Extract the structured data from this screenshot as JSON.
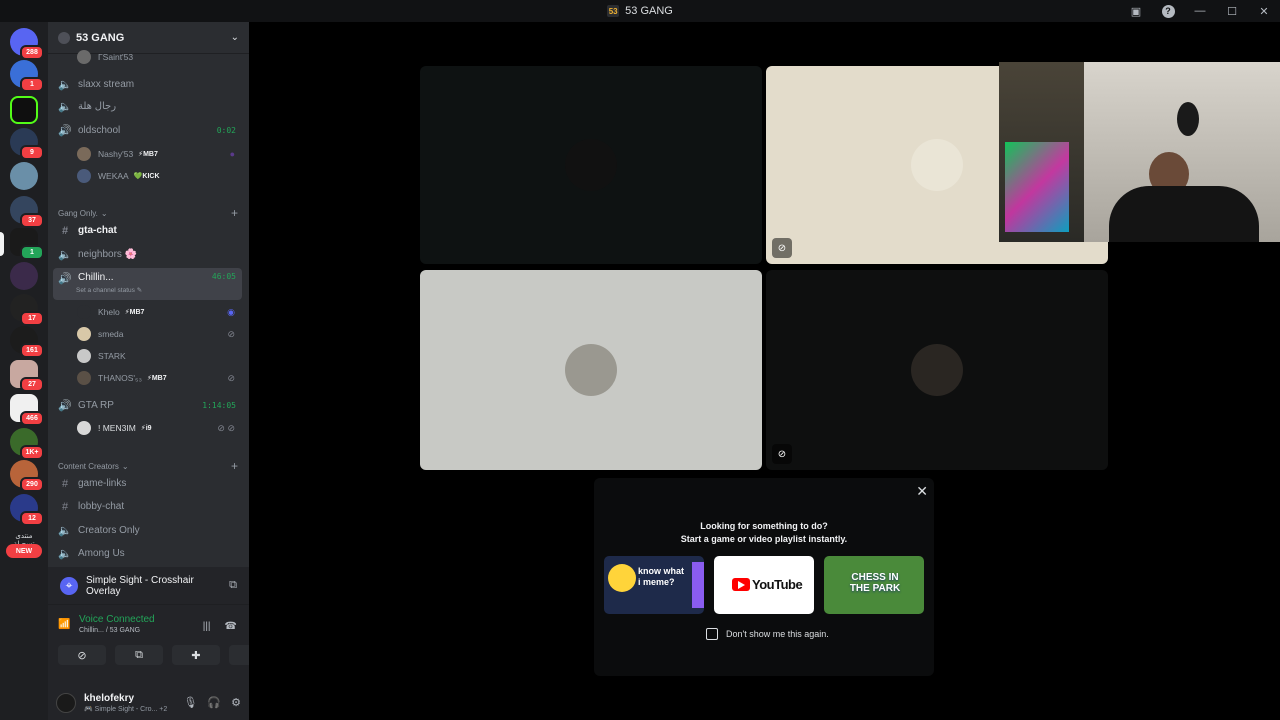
{
  "window": {
    "title": "53 GANG"
  },
  "server_rail": {
    "servers": [
      {
        "badge": "288"
      },
      {
        "badge": "1"
      },
      {
        "badge": ""
      },
      {
        "badge": "9"
      },
      {
        "badge": ""
      },
      {
        "badge": "37"
      },
      {
        "badge": "1"
      },
      {
        "badge": ""
      },
      {
        "badge": "17"
      },
      {
        "badge": "161"
      },
      {
        "badge": "27"
      },
      {
        "badge": "466"
      },
      {
        "badge": "1K+"
      },
      {
        "badge": "290"
      },
      {
        "badge": "12"
      }
    ],
    "arabic_folder_label": "منتدى تسجيلة",
    "new_badge": "NEW"
  },
  "server": {
    "name": "53 GANG"
  },
  "channels": {
    "partial_user": "ΓSaint'53",
    "ch1": "slaxx stream",
    "ch2": "رجال هلة",
    "ch3": "oldschool",
    "ch3_timer": "0:02",
    "ch3_users": [
      {
        "name": "Nashy'53",
        "tag": "⚡MB7"
      },
      {
        "name": "WEKAA",
        "tag": "💚KICK"
      }
    ],
    "cat1": "Gang Only.",
    "ch4": "gta-chat",
    "ch5": "neighbors 🌸",
    "ch6": "Chillin...",
    "ch6_timer": "46:05",
    "ch6_status": "Set a channel status ✎",
    "ch6_users": [
      {
        "name": "Khelo",
        "tag": "⚡MB7"
      },
      {
        "name": "smeda",
        "tag": ""
      },
      {
        "name": "STARK",
        "tag": ""
      },
      {
        "name": "THANOS'₅₃",
        "tag": "⚡MB7"
      }
    ],
    "ch7": "GTA RP",
    "ch7_timer": "1:14:05",
    "ch7_users": [
      {
        "name": "! MEN3IM",
        "tag": "⚡i9"
      }
    ],
    "cat2": "Content Creators",
    "ch8": "game-links",
    "ch9": "lobby-chat",
    "ch10": "Creators Only",
    "ch11": "Among Us"
  },
  "activity": {
    "label": "Simple Sight - Crosshair Overlay"
  },
  "voice": {
    "status": "Voice Connected",
    "location": "Chillin... / 53 GANG"
  },
  "user_panel": {
    "username": "khelofekry",
    "status": "🎮 Simple Sight - Cro...",
    "extra": "+2"
  },
  "suggest": {
    "line1": "Looking for something to do?",
    "line2": "Start a game or video playlist instantly.",
    "card1_text": "know what i meme?",
    "card2_text": "YouTube",
    "card3_text": "CHESS IN THE PARK",
    "dont_show": "Don't show me this again."
  },
  "colors": {
    "green": "#23a559",
    "red": "#f23f43",
    "blurple": "#5865f2"
  }
}
